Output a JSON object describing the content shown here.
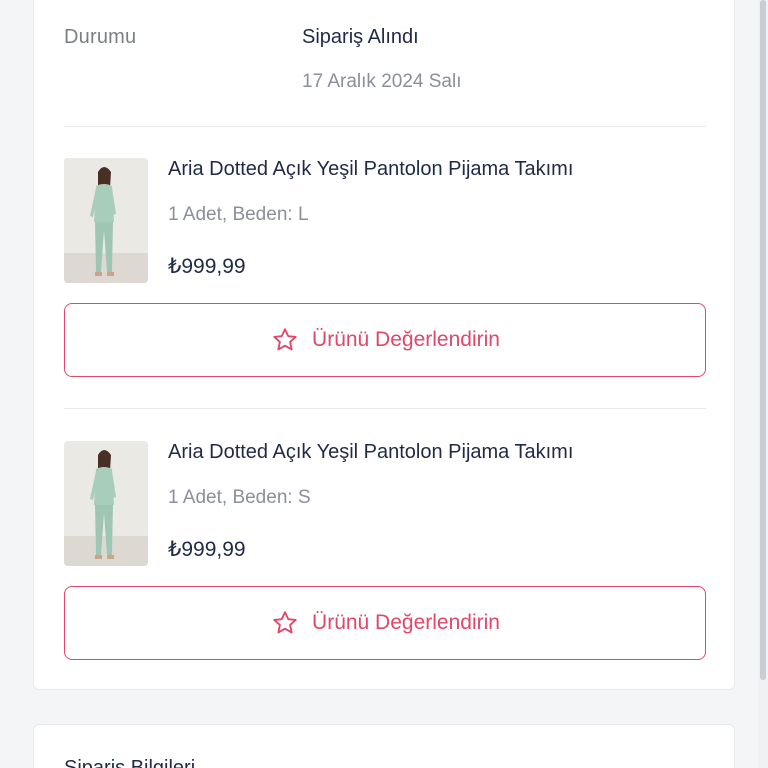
{
  "order_status": {
    "label": "Durumu",
    "value": "Sipariş Alındı",
    "date": "17 Aralık 2024 Salı"
  },
  "products": [
    {
      "name": "Aria Dotted Açık Yeşil Pantolon Pijama Takımı",
      "meta": "1 Adet, Beden: L",
      "price": "₺999,99",
      "rate_label": "Ürünü Değerlendirin"
    },
    {
      "name": "Aria Dotted Açık Yeşil Pantolon Pijama Takımı",
      "meta": "1 Adet, Beden: S",
      "price": "₺999,99",
      "rate_label": "Ürünü Değerlendirin"
    }
  ],
  "order_info": {
    "title": "Sipariş Bilgileri"
  },
  "colors": {
    "accent": "#e0476a",
    "text_primary": "#1f2a44",
    "text_secondary": "#8a8f99",
    "background": "#f4f5f7"
  },
  "icons": {
    "rate": "star-outline-icon"
  }
}
